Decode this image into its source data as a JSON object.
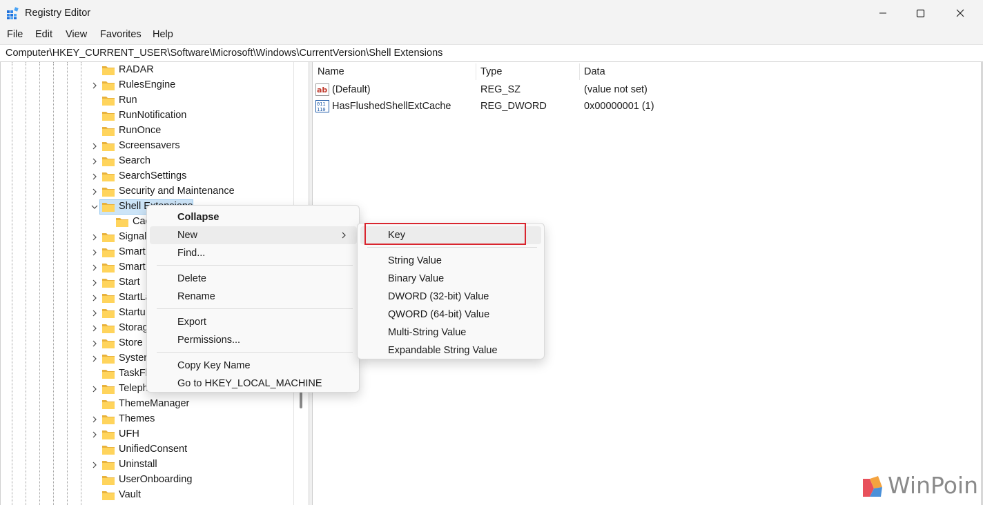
{
  "window": {
    "title": "Registry Editor"
  },
  "menubar": {
    "items": [
      "File",
      "Edit",
      "View",
      "Favorites",
      "Help"
    ]
  },
  "address": {
    "path": "Computer\\HKEY_CURRENT_USER\\Software\\Microsoft\\Windows\\CurrentVersion\\Shell Extensions"
  },
  "tree": {
    "items": [
      {
        "label": "RADAR",
        "expandable": false
      },
      {
        "label": "RulesEngine",
        "expandable": true
      },
      {
        "label": "Run",
        "expandable": false
      },
      {
        "label": "RunNotification",
        "expandable": false
      },
      {
        "label": "RunOnce",
        "expandable": false
      },
      {
        "label": "Screensavers",
        "expandable": true
      },
      {
        "label": "Search",
        "expandable": true
      },
      {
        "label": "SearchSettings",
        "expandable": true
      },
      {
        "label": "Security and Maintenance",
        "expandable": true
      },
      {
        "label": "Shell Extensions",
        "expandable": true,
        "expanded": true,
        "selected": true
      },
      {
        "label": "Cached",
        "expandable": false,
        "child": true
      },
      {
        "label": "Signal",
        "expandable": true
      },
      {
        "label": "Smart",
        "expandable": true
      },
      {
        "label": "Smart",
        "expandable": true
      },
      {
        "label": "Start",
        "expandable": true
      },
      {
        "label": "StartLa",
        "expandable": true
      },
      {
        "label": "Startu",
        "expandable": true
      },
      {
        "label": "Storag",
        "expandable": true
      },
      {
        "label": "Store",
        "expandable": true
      },
      {
        "label": "Syster",
        "expandable": true
      },
      {
        "label": "TaskFl",
        "expandable": false
      },
      {
        "label": "Teleph",
        "expandable": true
      },
      {
        "label": "ThemeManager",
        "expandable": false
      },
      {
        "label": "Themes",
        "expandable": true
      },
      {
        "label": "UFH",
        "expandable": true
      },
      {
        "label": "UnifiedConsent",
        "expandable": false
      },
      {
        "label": "Uninstall",
        "expandable": true
      },
      {
        "label": "UserOnboarding",
        "expandable": false
      },
      {
        "label": "Vault",
        "expandable": false
      }
    ]
  },
  "list": {
    "headers": {
      "name": "Name",
      "type": "Type",
      "data": "Data"
    },
    "rows": [
      {
        "icon": "string-value-icon",
        "name": "(Default)",
        "type": "REG_SZ",
        "data": "(value not set)"
      },
      {
        "icon": "binary-value-icon",
        "name": "HasFlushedShellExtCache",
        "type": "REG_DWORD",
        "data": "0x00000001 (1)"
      }
    ]
  },
  "context_menu": {
    "items": [
      "Collapse",
      "New",
      "Find...",
      "Delete",
      "Rename",
      "Export",
      "Permissions...",
      "Copy Key Name",
      "Go to HKEY_LOCAL_MACHINE"
    ],
    "bold_item": "Collapse",
    "hovered_item": "New"
  },
  "submenu": {
    "items": [
      "Key",
      "String Value",
      "Binary Value",
      "DWORD (32-bit) Value",
      "QWORD (64-bit) Value",
      "Multi-String Value",
      "Expandable String Value"
    ],
    "highlighted_item": "Key",
    "highlight_color": "#d9252e"
  },
  "watermark": {
    "text": "WinPoin"
  }
}
